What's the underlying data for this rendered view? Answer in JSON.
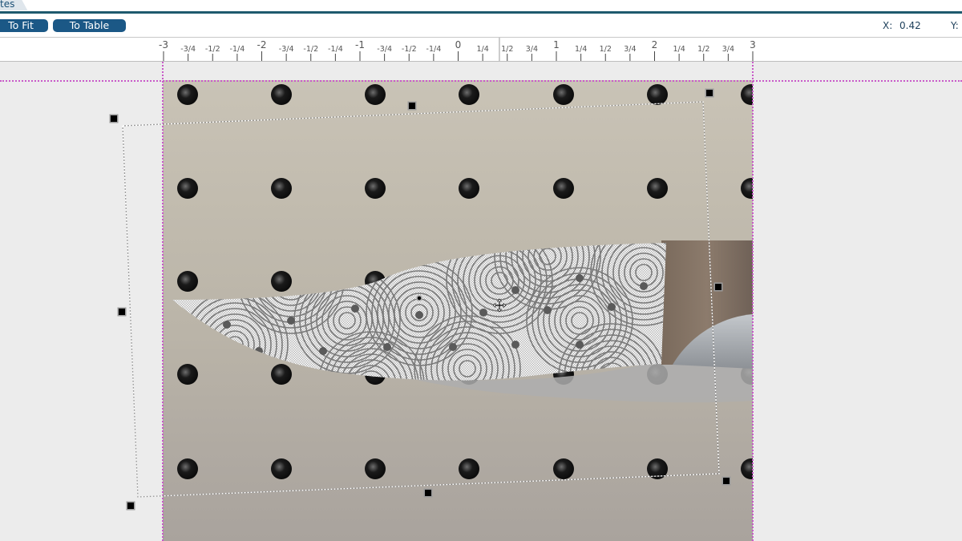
{
  "window": {
    "tab_label": "tes",
    "accent_color": "#1e5a6e"
  },
  "toolbar": {
    "to_fit_label": "To Fit",
    "to_table_label": "To Table",
    "button_color": "#1b5886"
  },
  "cursor_readout": {
    "x_label": "X:",
    "x_value": "0.42",
    "y_label": "Y:"
  },
  "ruler": {
    "unit_min": -3,
    "unit_max": 3,
    "labels": [
      {
        "value": -3,
        "text": "-3",
        "major": true
      },
      {
        "value": -2.75,
        "text": "-3/4",
        "major": false
      },
      {
        "value": -2.5,
        "text": "-1/2",
        "major": false
      },
      {
        "value": -2.25,
        "text": "-1/4",
        "major": false
      },
      {
        "value": -2,
        "text": "-2",
        "major": true
      },
      {
        "value": -1.75,
        "text": "-3/4",
        "major": false
      },
      {
        "value": -1.5,
        "text": "-1/2",
        "major": false
      },
      {
        "value": -1.25,
        "text": "-1/4",
        "major": false
      },
      {
        "value": -1,
        "text": "-1",
        "major": true
      },
      {
        "value": -0.75,
        "text": "-3/4",
        "major": false
      },
      {
        "value": -0.5,
        "text": "-1/2",
        "major": false
      },
      {
        "value": -0.25,
        "text": "-1/4",
        "major": false
      },
      {
        "value": 0,
        "text": "0",
        "major": true
      },
      {
        "value": 0.25,
        "text": "1/4",
        "major": false
      },
      {
        "value": 0.5,
        "text": "1/2",
        "major": false
      },
      {
        "value": 0.75,
        "text": "3/4",
        "major": false
      },
      {
        "value": 1,
        "text": "1",
        "major": true
      },
      {
        "value": 1.25,
        "text": "1/4",
        "major": false
      },
      {
        "value": 1.5,
        "text": "1/2",
        "major": false
      },
      {
        "value": 1.75,
        "text": "3/4",
        "major": false
      },
      {
        "value": 2,
        "text": "2",
        "major": true
      },
      {
        "value": 2.25,
        "text": "1/4",
        "major": false
      },
      {
        "value": 2.5,
        "text": "1/2",
        "major": false
      },
      {
        "value": 2.75,
        "text": "3/4",
        "major": false
      },
      {
        "value": 3,
        "text": "3",
        "major": true
      }
    ],
    "cursor_marker_value": 0.42
  },
  "canvas": {
    "background_image": "pegboard-with-knife-photo",
    "engraving_pattern": "interlocking-arc-pattern",
    "guide_color": "#c85ac8"
  },
  "selection": {
    "handles": [
      "top-left",
      "top-mid",
      "top-right",
      "mid-left",
      "mid-right",
      "bottom-left",
      "bottom-mid",
      "bottom-right"
    ]
  }
}
